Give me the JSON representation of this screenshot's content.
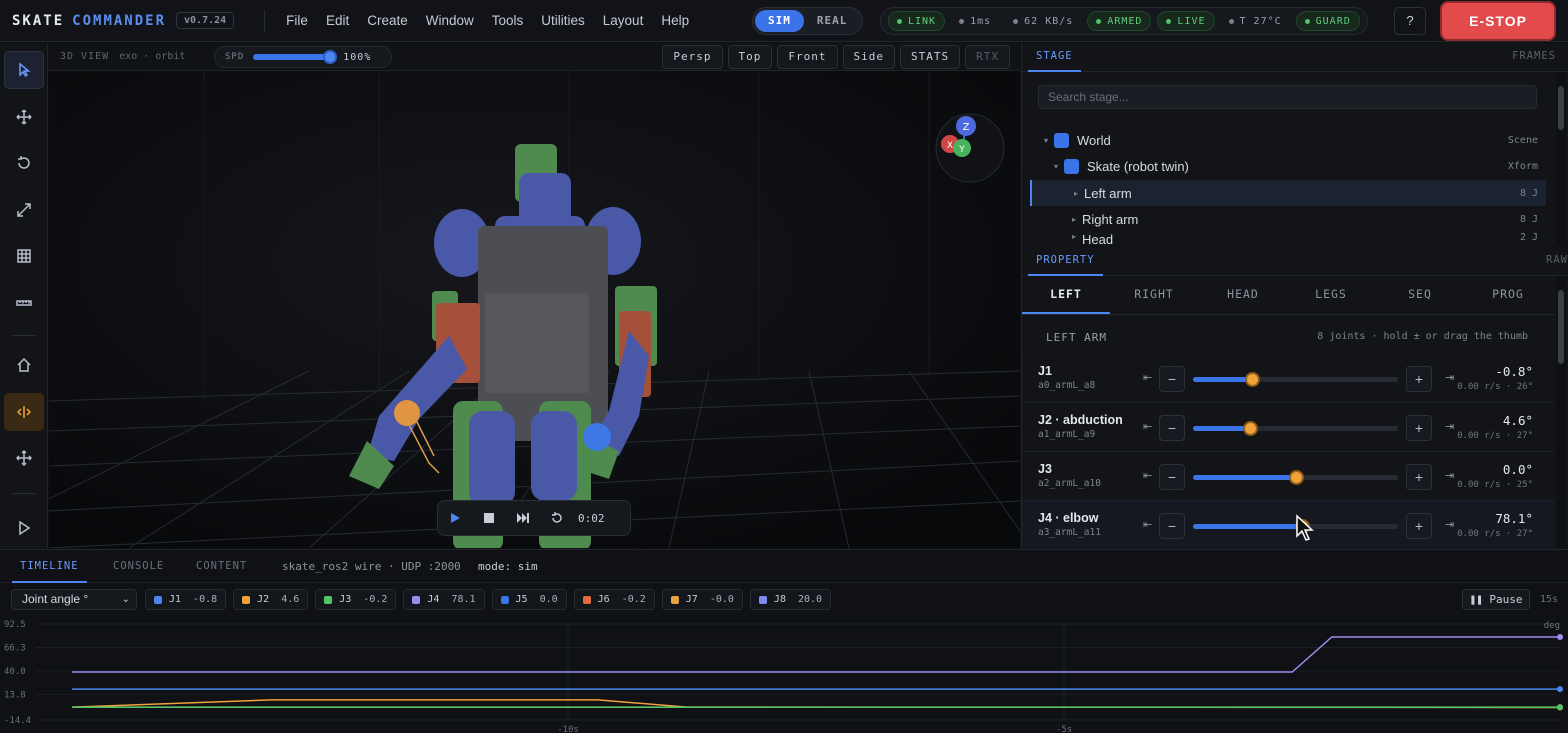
{
  "app": {
    "brand_a": "SKATE",
    "brand_b": "COMMANDER",
    "version": "v0.7.24",
    "menu": [
      "File",
      "Edit",
      "Create",
      "Window",
      "Tools",
      "Utilities",
      "Layout",
      "Help"
    ],
    "modes": [
      "SIM",
      "REAL"
    ],
    "active_mode": "SIM",
    "status": [
      {
        "label": "LINK",
        "state": "ok"
      },
      {
        "label": "1ms",
        "state": "neutral"
      },
      {
        "label": "62 KB/s",
        "state": "neutral"
      },
      {
        "label": "ARMED",
        "state": "ok"
      },
      {
        "label": "LIVE",
        "state": "ok"
      },
      {
        "label": "T 27°C",
        "state": "neutral"
      },
      {
        "label": "GUARD",
        "state": "ok"
      }
    ],
    "help": "?",
    "estop": "E-STOP",
    "colors": {
      "accent": "#3a74e8",
      "estop": "#e34a4c",
      "ok": "#4ec46c",
      "joint_knob": "#f0a23b"
    }
  },
  "tools": [
    "select-icon",
    "move-icon",
    "rotate-icon",
    "scale-icon",
    "grid-icon",
    "ruler-icon",
    "home-icon",
    "split-icon",
    "transform-icon",
    "play-icon"
  ],
  "viewport": {
    "title": "3D VIEW",
    "subtitle": "exo · orbit",
    "speed_label": "SPD",
    "speed_value": "100%",
    "speed_fraction": 1.0,
    "views": [
      "Persp",
      "Top",
      "Front",
      "Side",
      "STATS",
      "RTX"
    ],
    "gizmo": {
      "z": "Z",
      "x": "X",
      "y": "Y"
    },
    "time": "0:02"
  },
  "stage": {
    "tab": "STAGE",
    "tab2": "FRAMES",
    "search_placeholder": "Search stage...",
    "items": [
      {
        "name": "World",
        "type": "Scene"
      },
      {
        "name": "Skate (robot twin)",
        "type": "Xform"
      },
      {
        "name": "Left arm",
        "type": "8 J"
      },
      {
        "name": "Right arm",
        "type": "8 J"
      },
      {
        "name": "Head",
        "type": "2 J"
      }
    ]
  },
  "property": {
    "tab": "PROPERTY",
    "tab2": "RAW",
    "joint_tabs": [
      "LEFT",
      "RIGHT",
      "HEAD",
      "LEGS",
      "SEQ",
      "PROG"
    ],
    "section": "LEFT ARM",
    "hint": "8 joints · hold ± or drag the thumb",
    "joints": [
      {
        "name": "J1",
        "id": "a0_armL_a8",
        "value": "-0.8°",
        "rate": "0.00 r/s · 26°",
        "pos": 0.29
      },
      {
        "name": "J2 · abduction",
        "id": "a1_armL_a9",
        "value": "4.6°",
        "rate": "0.00 r/s · 27°",
        "pos": 0.28
      },
      {
        "name": "J3",
        "id": "a2_armL_a10",
        "value": "0.0°",
        "rate": "0.00 r/s · 25°",
        "pos": 0.5
      },
      {
        "name": "J4 · elbow",
        "id": "a3_armL_a11",
        "value": "78.1°",
        "rate": "0.00 r/s · 27°",
        "pos": 0.53
      }
    ]
  },
  "bottom": {
    "tabs": [
      "TIMELINE",
      "CONSOLE",
      "CONTENT"
    ],
    "wire": "skate_ros2 wire · UDP :2000",
    "mode": "mode: sim",
    "metric": "Joint angle °",
    "legend": [
      {
        "name": "J1",
        "value": "-0.8",
        "color": "#4d86f2"
      },
      {
        "name": "J2",
        "value": "4.6",
        "color": "#f0a23b"
      },
      {
        "name": "J3",
        "value": "-0.2",
        "color": "#4ec46c"
      },
      {
        "name": "J4",
        "value": "78.1",
        "color": "#9a8cf0"
      },
      {
        "name": "J5",
        "value": "0.0",
        "color": "#3a74e8"
      },
      {
        "name": "J6",
        "value": "-0.2",
        "color": "#e06a3c"
      },
      {
        "name": "J7",
        "value": "-0.0",
        "color": "#e8a040"
      },
      {
        "name": "J8",
        "value": "20.0",
        "color": "#7b8cf0"
      }
    ],
    "pause": "Pause",
    "window": "15s",
    "unit": "deg"
  },
  "chart_data": {
    "type": "line",
    "ylim": [
      -14.4,
      92.5
    ],
    "y_ticks": [
      "92.5",
      "66.3",
      "40.0",
      "13.8",
      "-14.4"
    ],
    "x_ticks": [
      "-10s",
      "-5s"
    ],
    "xlim": [
      -15,
      0
    ],
    "series": [
      {
        "name": "J4",
        "color": "#9a8cf0",
        "points": [
          [
            -15,
            39
          ],
          [
            -2.7,
            39
          ],
          [
            -2.3,
            78
          ],
          [
            -0.6,
            78
          ],
          [
            0,
            78
          ]
        ]
      },
      {
        "name": "J8",
        "color": "#4d86f2",
        "points": [
          [
            -15,
            20
          ],
          [
            0,
            20
          ]
        ]
      },
      {
        "name": "J2",
        "color": "#f0a23b",
        "points": [
          [
            -15,
            0
          ],
          [
            -13,
            8
          ],
          [
            -9.7,
            8
          ],
          [
            -8.8,
            0
          ],
          [
            0,
            0
          ]
        ]
      },
      {
        "name": "J7",
        "color": "#e8a040",
        "points": [
          [
            -15,
            0
          ],
          [
            -8.8,
            0
          ],
          [
            0,
            -0.5
          ]
        ]
      },
      {
        "name": "J3",
        "color": "#4ec46c",
        "points": [
          [
            -15,
            -0.2
          ],
          [
            0,
            -0.2
          ]
        ]
      }
    ]
  }
}
